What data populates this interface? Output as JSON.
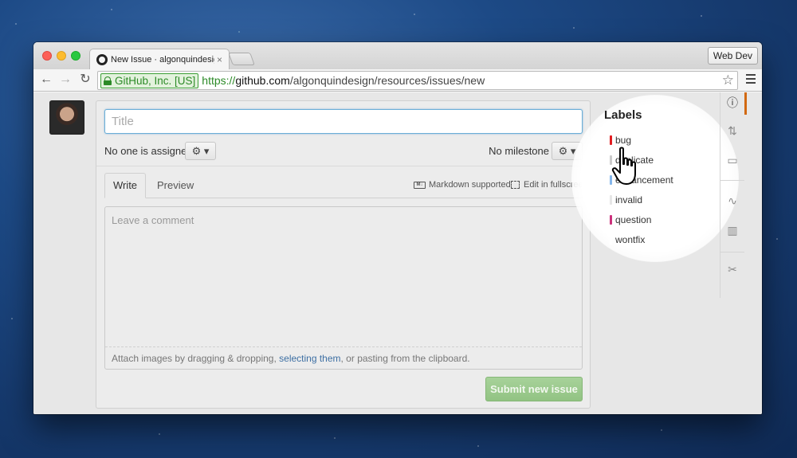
{
  "browser": {
    "tab_title": "New Issue · algonquindesign",
    "tab_close": "×",
    "profile_label": "Web Dev",
    "ev_label": "GitHub, Inc. [US]",
    "url_scheme": "https://",
    "url_host": "github.com",
    "url_path": "/algonquindesign/resources/issues/new",
    "nav": {
      "back": "←",
      "forward": "→",
      "reload": "↻",
      "star": "☆"
    }
  },
  "issue_form": {
    "title_placeholder": "Title",
    "assignee_text": "No one is assigned",
    "milestone_text": "No milestone",
    "gear_glyph": "⚙ ▾",
    "tab_write": "Write",
    "tab_preview": "Preview",
    "markdown_label": "Markdown supported",
    "markdown_icon_text": "M↓",
    "fullscreen_label": "Edit in fullscreen",
    "comment_placeholder": "Leave a comment",
    "attach_prefix": "Attach images by dragging & dropping, ",
    "attach_link": "selecting them",
    "attach_suffix": ", or pasting from the clipboard.",
    "submit_label": "Submit new issue"
  },
  "labels": {
    "title": "Labels",
    "items": [
      {
        "name": "bug",
        "color": "#e11d21"
      },
      {
        "name": "duplicate",
        "color": "#cccccc"
      },
      {
        "name": "enhancement",
        "color": "#84b6eb"
      },
      {
        "name": "invalid",
        "color": "#e6e6e6"
      },
      {
        "name": "question",
        "color": "#cc317c"
      },
      {
        "name": "wontfix",
        "color": "#ffffff"
      }
    ]
  },
  "rail": {
    "icons": [
      "issues-icon",
      "pull-request-icon",
      "wiki-icon",
      "pulse-icon",
      "graphs-icon",
      "settings-icon"
    ],
    "glyphs": [
      "ⓘ",
      "⇅",
      "▭",
      "∿",
      "▥",
      "✂"
    ]
  },
  "colors": {
    "accent_green": "#2c8a27",
    "submit_button": "#92c383",
    "active_rail": "#d26911",
    "link_blue": "#3d6fa3"
  }
}
